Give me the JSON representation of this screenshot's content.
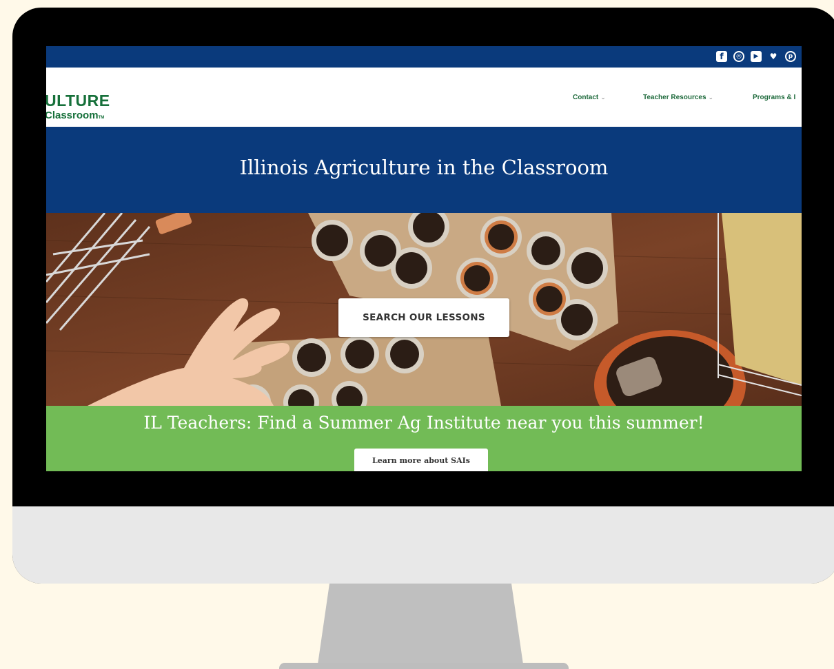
{
  "site": {
    "logo_line1": "ULTURE",
    "logo_line2": "Classroom",
    "logo_mark": "TM",
    "social_icons": [
      "facebook-icon",
      "instagram-icon",
      "youtube-icon",
      "twitter-icon",
      "pinterest-icon"
    ],
    "colors": {
      "topbar": "#0a3a7c",
      "nav_text": "#1e6a3c",
      "green_band": "#72bb56",
      "desk": "#6b3a22"
    }
  },
  "nav": {
    "items": [
      {
        "label": "Contact",
        "chevron": "⌄"
      },
      {
        "label": "Teacher Resources",
        "chevron": "⌄"
      },
      {
        "label": "Programs & I",
        "chevron": ""
      }
    ]
  },
  "hero": {
    "title": "Illinois Agriculture in the Classroom",
    "search_button": "SEARCH OUR LESSONS"
  },
  "banner": {
    "text": "IL Teachers: Find a Summer Ag Institute near you this summer!",
    "button": "Learn more about SAIs"
  }
}
